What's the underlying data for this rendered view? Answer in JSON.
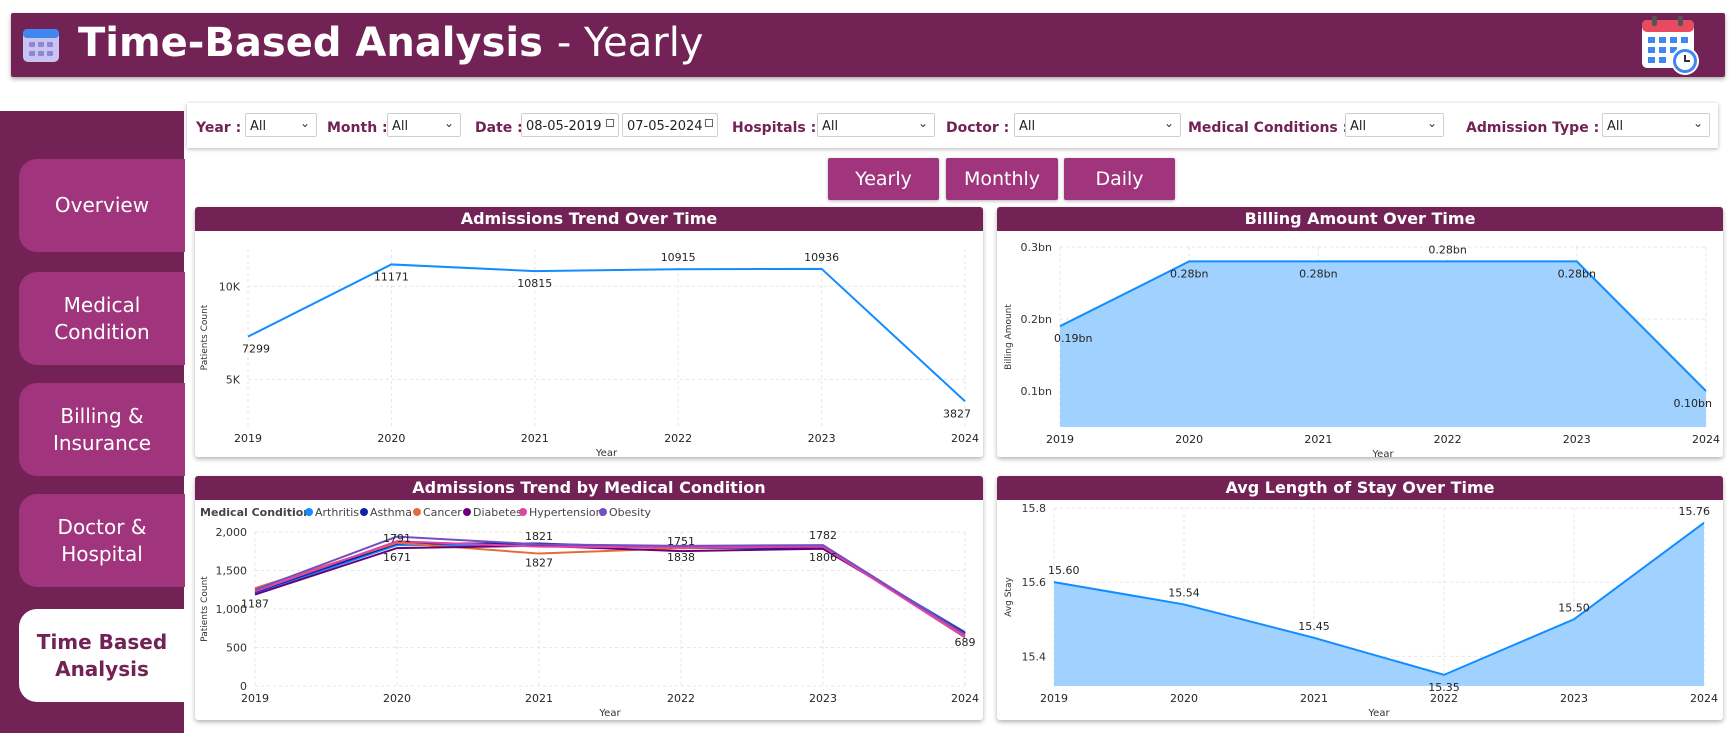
{
  "header": {
    "title": "Time-Based Analysis",
    "subtitle": "- Yearly",
    "icon": "calendar-icon",
    "right_icon": "calendar-clock-icon"
  },
  "sidebar": {
    "items": [
      {
        "label_line1": "Overview",
        "label_line2": ""
      },
      {
        "label_line1": "Medical",
        "label_line2": "Condition"
      },
      {
        "label_line1": "Billing &",
        "label_line2": "Insurance"
      },
      {
        "label_line1": "Doctor &",
        "label_line2": "Hospital"
      },
      {
        "label_line1": "Time Based",
        "label_line2": "Analysis"
      }
    ]
  },
  "filters": {
    "year_label": "Year :",
    "year_value": "All",
    "month_label": "Month :",
    "month_value": "All",
    "date_label": "Date :",
    "date_start": "08-05-2019",
    "date_end": "07-05-2024",
    "hospitals_label": "Hospitals :",
    "hospitals_value": "All",
    "doctor_label": "Doctor :",
    "doctor_value": "All",
    "conditions_label": "Medical Conditions :",
    "conditions_value": "All",
    "admission_label": "Admission Type :",
    "admission_value": "All"
  },
  "tabs": {
    "yearly": "Yearly",
    "monthly": "Monthly",
    "daily": "Daily"
  },
  "colors": {
    "brand": "#722254",
    "accent": "#a0357d",
    "line": "#118DFF",
    "area": "#A0D1FF"
  },
  "chart_data": [
    {
      "id": "admissions",
      "type": "line",
      "title": "Admissions Trend Over Time",
      "xlabel": "Year",
      "ylabel": "Patients Count",
      "x": [
        "2019",
        "2020",
        "2021",
        "2022",
        "2023",
        "2024"
      ],
      "values": [
        7299,
        11171,
        10815,
        10915,
        10936,
        3827
      ],
      "labels": [
        "7299",
        "11171",
        "10815",
        "10915",
        "10936",
        "3827"
      ],
      "ylim": [
        2500,
        12000
      ],
      "yticks": [
        5000,
        10000
      ],
      "ytick_labels": [
        "5K",
        "10K"
      ]
    },
    {
      "id": "billing",
      "type": "area",
      "title": "Billing Amount Over Time",
      "xlabel": "Year",
      "ylabel": "Billing Amount",
      "x": [
        "2019",
        "2020",
        "2021",
        "2022",
        "2023",
        "2024"
      ],
      "values": [
        0.19,
        0.28,
        0.28,
        0.28,
        0.28,
        0.1
      ],
      "labels": [
        "0.19bn",
        "0.28bn",
        "0.28bn",
        "0.28bn",
        "0.28bn",
        "0.10bn"
      ],
      "ylim": [
        0.05,
        0.3
      ],
      "yticks": [
        0.1,
        0.2,
        0.3
      ],
      "ytick_labels": [
        "0.1bn",
        "0.2bn",
        "0.3bn"
      ]
    },
    {
      "id": "conditions",
      "type": "line",
      "title": "Admissions Trend by Medical Condition",
      "legend_title": "Medical Condition",
      "xlabel": "Year",
      "ylabel": "Patients Count",
      "x": [
        "2019",
        "2020",
        "2021",
        "2022",
        "2023",
        "2024"
      ],
      "ylim": [
        0,
        2000
      ],
      "yticks": [
        0,
        500,
        1000,
        1500,
        2000
      ],
      "ytick_labels": [
        "0",
        "500",
        "1,000",
        "1,500",
        "2,000"
      ],
      "series": [
        {
          "name": "Arthritis",
          "color": "#118DFF",
          "values": [
            1200,
            1830,
            1830,
            1800,
            1790,
            700
          ]
        },
        {
          "name": "Asthma",
          "color": "#12239E",
          "values": [
            1220,
            1850,
            1850,
            1790,
            1800,
            680
          ]
        },
        {
          "name": "Cancer",
          "color": "#E66C37",
          "values": [
            1270,
            1860,
            1720,
            1790,
            1820,
            650
          ]
        },
        {
          "name": "Diabetes",
          "color": "#6B007B",
          "values": [
            1187,
            1791,
            1821,
            1751,
            1782,
            689
          ]
        },
        {
          "name": "Hypertension",
          "color": "#E044A7",
          "values": [
            1230,
            1880,
            1810,
            1800,
            1810,
            630
          ]
        },
        {
          "name": "Obesity",
          "color": "#744EC2",
          "values": [
            1250,
            1940,
            1840,
            1820,
            1830,
            670
          ]
        }
      ],
      "point_labels": [
        {
          "x": "2019",
          "text": "1187",
          "value": 1187,
          "pos": "below"
        },
        {
          "x": "2020",
          "text": "1791",
          "value": 1791,
          "pos": "above"
        },
        {
          "x": "2020",
          "text": "1671",
          "value": 1791,
          "pos": "below"
        },
        {
          "x": "2021",
          "text": "1821",
          "value": 1821,
          "pos": "above"
        },
        {
          "x": "2021",
          "text": "1827",
          "value": 1720,
          "pos": "below"
        },
        {
          "x": "2022",
          "text": "1751",
          "value": 1751,
          "pos": "above"
        },
        {
          "x": "2022",
          "text": "1838",
          "value": 1790,
          "pos": "below"
        },
        {
          "x": "2023",
          "text": "1782",
          "value": 1830,
          "pos": "above"
        },
        {
          "x": "2023",
          "text": "1806",
          "value": 1790,
          "pos": "below"
        },
        {
          "x": "2024",
          "text": "689",
          "value": 689,
          "pos": "below"
        }
      ]
    },
    {
      "id": "stay",
      "type": "area",
      "title": "Avg Length of Stay Over Time",
      "xlabel": "Year",
      "ylabel": "Avg Stay",
      "x": [
        "2019",
        "2020",
        "2021",
        "2022",
        "2023",
        "2024"
      ],
      "values": [
        15.6,
        15.54,
        15.45,
        15.35,
        15.5,
        15.76
      ],
      "labels": [
        "15.60",
        "15.54",
        "15.45",
        "15.35",
        "15.50",
        "15.76"
      ],
      "ylim": [
        15.32,
        15.8
      ],
      "yticks": [
        15.4,
        15.6,
        15.8
      ],
      "ytick_labels": [
        "15.4",
        "15.6",
        "15.8"
      ]
    }
  ]
}
